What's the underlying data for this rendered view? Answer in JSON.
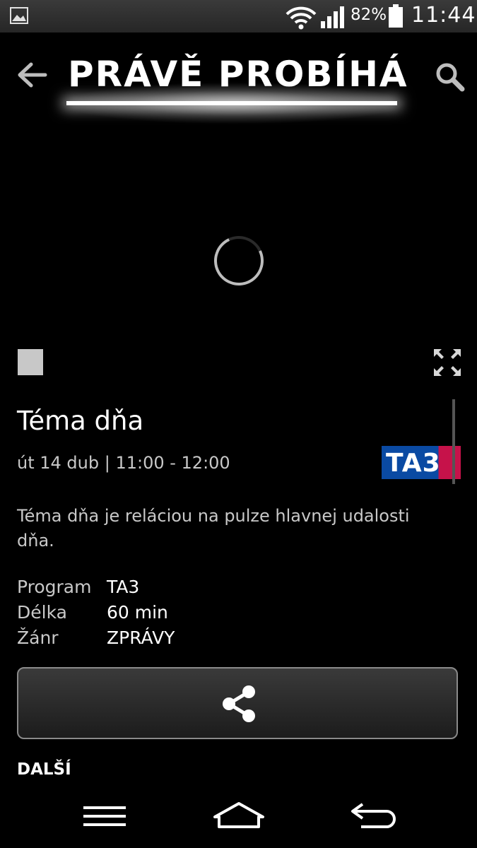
{
  "status_bar": {
    "battery_percent": "82%",
    "time": "11:44",
    "icons": [
      "image-icon",
      "wifi-icon",
      "signal-icon",
      "battery-icon"
    ]
  },
  "header": {
    "title": "PRÁVĚ PROBÍHÁ",
    "icons": [
      "back-arrow-icon",
      "search-icon"
    ]
  },
  "player": {
    "icons": [
      "loading-spinner-icon",
      "stop-icon",
      "fullscreen-icon"
    ]
  },
  "program": {
    "title": "Téma dňa",
    "time": "út 14 dub | 11:00 - 12:00",
    "channel_logo_text": "TA3",
    "description": "Téma dňa je reláciou na pulze hlavnej udalosti dňa.",
    "details": [
      {
        "label": "Program",
        "value": "TA3"
      },
      {
        "label": "Délka",
        "value": "60 min"
      },
      {
        "label": "Žánr",
        "value": "ZPRÁVY"
      }
    ]
  },
  "share": {
    "icon": "share-icon"
  },
  "next_section": {
    "label": "DALŠÍ"
  },
  "nav_bar": {
    "icons": [
      "menu-icon",
      "home-icon",
      "back-icon"
    ]
  }
}
